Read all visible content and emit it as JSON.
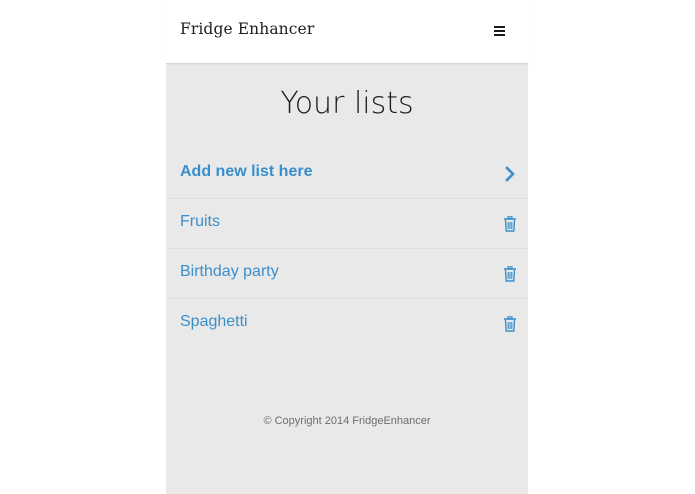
{
  "navbar": {
    "brand": "Fridge Enhancer",
    "menu_icon": "hamburger-menu-icon"
  },
  "main": {
    "title": "Your lists",
    "add_item": {
      "label": "Add new list here",
      "icon": "chevron-right-icon"
    },
    "lists": [
      {
        "label": "Fruits",
        "icon": "trash-icon"
      },
      {
        "label": "Birthday party",
        "icon": "trash-icon"
      },
      {
        "label": "Spaghetti",
        "icon": "trash-icon"
      }
    ]
  },
  "footer": {
    "copyright": "© Copyright 2014 FridgeEnhancer"
  },
  "colors": {
    "accent": "#3a8fcb",
    "background": "#e9e9e9",
    "navbar": "#ffffff"
  }
}
